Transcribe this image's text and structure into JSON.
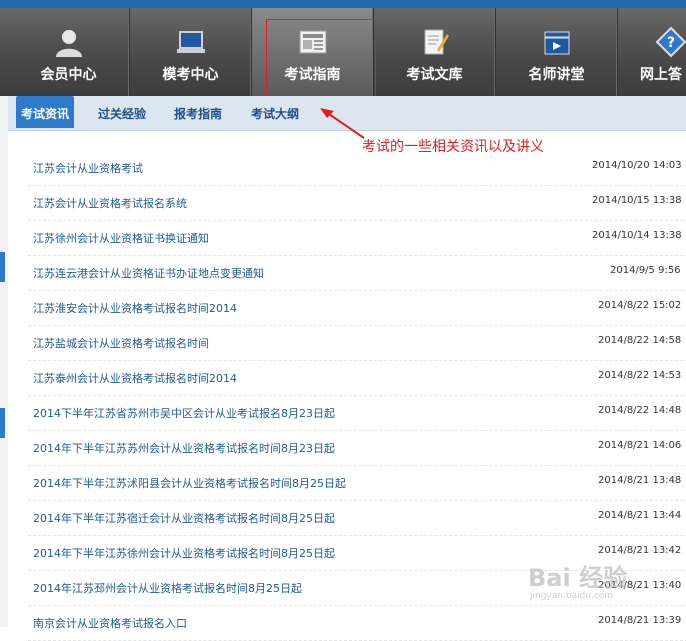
{
  "nav": {
    "items": [
      {
        "label": "会员中心",
        "icon": "user-icon"
      },
      {
        "label": "模考中心",
        "icon": "laptop-icon"
      },
      {
        "label": "考试指南",
        "icon": "newspaper-icon",
        "active": true
      },
      {
        "label": "考试文库",
        "icon": "notepad-pencil-icon"
      },
      {
        "label": "名师讲堂",
        "icon": "clapperboard-icon"
      },
      {
        "label": "网上答",
        "icon": "diamond-help-icon"
      }
    ]
  },
  "subtabs": [
    "考试资讯",
    "过关经验",
    "报考指南",
    "考试大纲"
  ],
  "annotation": "考试的一些相关资讯以及讲义",
  "articles": [
    {
      "title": "江苏会计从业资格考试",
      "date": "2014/10/20 14:03"
    },
    {
      "title": "江苏会计从业资格考试报名系统",
      "date": "2014/10/15 13:38"
    },
    {
      "title": "江苏徐州会计从业资格证书换证通知",
      "date": "2014/10/14 13:38"
    },
    {
      "title": "江苏连云港会计从业资格证书办证地点变更通知",
      "date": "2014/9/5 9:56"
    },
    {
      "title": "江苏淮安会计从业资格考试报名时间2014",
      "date": "2014/8/22 15:02"
    },
    {
      "title": "江苏盐城会计从业资格考试报名时间",
      "date": "2014/8/22 14:58"
    },
    {
      "title": "江苏泰州会计从业资格考试报名时间2014",
      "date": "2014/8/22 14:53"
    },
    {
      "title": "2014下半年江苏省苏州市吴中区会计从业考试报名8月23日起",
      "date": "2014/8/22 14:48"
    },
    {
      "title": "2014年下半年江苏苏州会计从业资格考试报名时间8月23日起",
      "date": "2014/8/21 14:06"
    },
    {
      "title": "2014年下半年江苏沭阳县会计从业资格考试报名时间8月25日起",
      "date": "2014/8/21 13:48"
    },
    {
      "title": "2014年下半年江苏宿迁会计从业资格考试报名时间8月25日起",
      "date": "2014/8/21 13:44"
    },
    {
      "title": "2014年下半年江苏徐州会计从业资格考试报名时间8月25日起",
      "date": "2014/8/21 13:42"
    },
    {
      "title": "2014年江苏邳州会计从业资格考试报名时间8月25日起",
      "date": "2014/8/21 13:40"
    },
    {
      "title": "南京会计从业资格考试报名入口",
      "date": "2014/8/21 13:39"
    }
  ],
  "watermark": {
    "main": "Bai 经验",
    "sub": "jingyan.baidu.com"
  },
  "colors": {
    "accent": "#2f7ac8",
    "link": "#1f5a96",
    "annotation": "#e02020"
  }
}
